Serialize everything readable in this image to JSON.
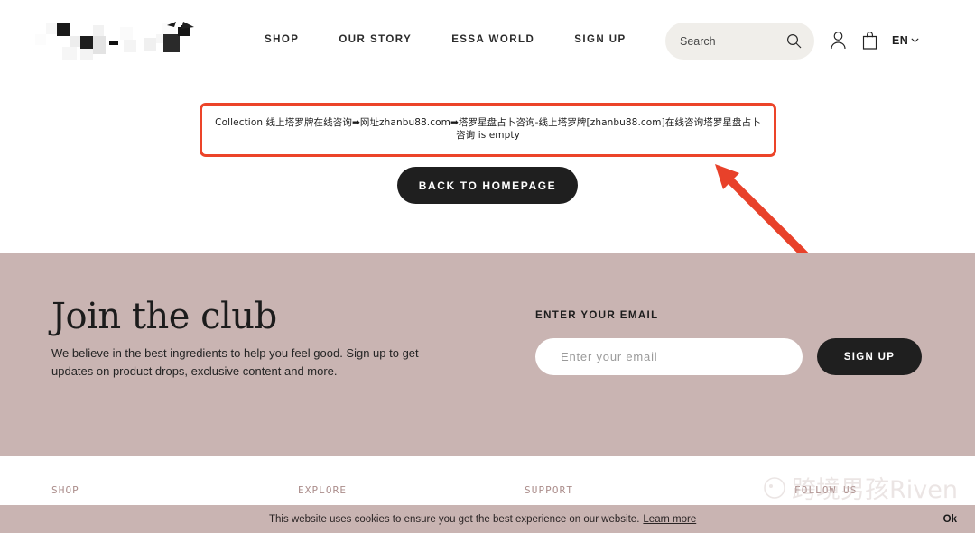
{
  "header": {
    "logo_alt": "essa-logo-pixelated",
    "nav": [
      {
        "label": "SHOP"
      },
      {
        "label": "OUR STORY"
      },
      {
        "label": "ESSA WORLD"
      },
      {
        "label": "SIGN UP"
      }
    ],
    "search": {
      "placeholder": "Search",
      "value": ""
    },
    "language": {
      "label": "EN"
    }
  },
  "main": {
    "notice": "Collection 线上塔罗牌在线咨询➡网址zhanbu88.com➡塔罗星盘占卜咨询-线上塔罗牌[zhanbu88.com]在线咨询塔罗星盘占卜咨询 is empty",
    "back_button": "BACK TO HOMEPAGE"
  },
  "annotation": {
    "box_color": "#ec4429",
    "arrow_color": "#e8412a"
  },
  "newsletter": {
    "title": "Join the club",
    "copy": "We believe in the best ingredients to help you feel good. Sign up to get updates on product drops, exclusive content and more.",
    "email_label": "ENTER YOUR EMAIL",
    "email_placeholder": "Enter your email",
    "email_value": "",
    "signup_button": "SIGN UP",
    "background": "#c9b4b2"
  },
  "footer": {
    "columns": [
      {
        "heading": "SHOP"
      },
      {
        "heading": "EXPLORE"
      },
      {
        "heading": "SUPPORT"
      },
      {
        "heading": "FOLLOW US"
      }
    ],
    "heading_color": "#ab8d8b"
  },
  "watermark": {
    "text": "跨境男孩Riven"
  },
  "cookie_banner": {
    "message": "This website uses cookies to ensure you get the best experience on our website.",
    "link": "Learn more",
    "accept": "Ok",
    "background": "#c9b4b2"
  }
}
